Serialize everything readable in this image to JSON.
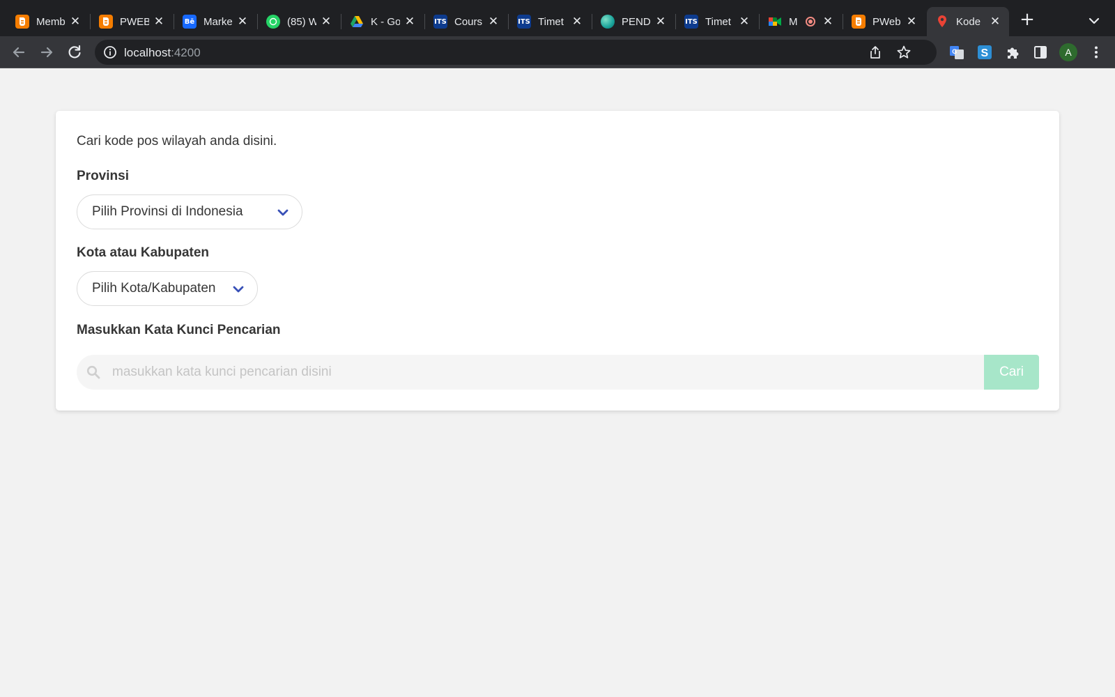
{
  "browser": {
    "tabs": [
      {
        "title": "Memb",
        "icon": "blogger-icon",
        "color": "#f57d00"
      },
      {
        "title": "PWEB",
        "icon": "blogger-icon",
        "color": "#f57d00"
      },
      {
        "title": "Marke",
        "icon": "behance-icon",
        "color": "#1769ff",
        "glyph": "Bē"
      },
      {
        "title": "(85) W",
        "icon": "whatsapp-icon",
        "color": "#25d366"
      },
      {
        "title": "K - Go",
        "icon": "google-drive-icon",
        "color": "#fbbc04"
      },
      {
        "title": "Cours",
        "icon": "its-icon",
        "color": "#0d3b8e",
        "glyph": "ITS"
      },
      {
        "title": "Timet",
        "icon": "its-icon",
        "color": "#0d3b8e",
        "glyph": "ITS"
      },
      {
        "title": "PEND",
        "icon": "sphere-icon",
        "color": "#1aa39a"
      },
      {
        "title": "Timet",
        "icon": "its-icon",
        "color": "#0d3b8e",
        "glyph": "ITS"
      },
      {
        "title": "M",
        "icon": "google-meet-icon",
        "color": "#00832d"
      },
      {
        "title": "PWeb",
        "icon": "blogger-icon",
        "color": "#f57d00"
      },
      {
        "title": "Kode",
        "icon": "map-pin-icon",
        "color": "#ea4335",
        "active": true
      }
    ],
    "url_host": "localhost",
    "url_port": ":4200",
    "profile_initial": "A"
  },
  "page": {
    "intro": "Cari kode pos wilayah anda disini.",
    "province_label": "Provinsi",
    "province_select": "Pilih Provinsi di Indonesia",
    "city_label": "Kota atau Kabupaten",
    "city_select": "Pilih Kota/Kabupaten",
    "keyword_label": "Masukkan Kata Kunci Pencarian",
    "search_placeholder": "masukkan kata kunci pencarian disini",
    "search_button": "Cari",
    "accent_color": "#3850b7",
    "button_color": "#a7e6c9"
  }
}
